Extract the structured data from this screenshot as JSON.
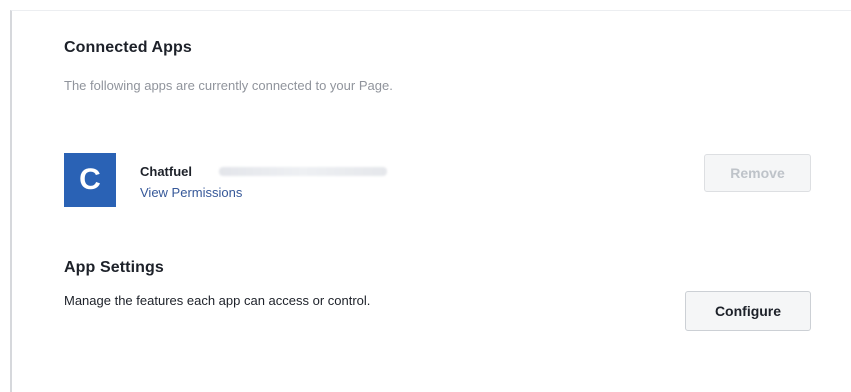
{
  "connected_apps": {
    "title": "Connected Apps",
    "description": "The following apps are currently connected to your Page.",
    "apps": [
      {
        "icon_letter": "C",
        "icon_color": "#2a62b5",
        "name": "Chatfuel",
        "link_label": "View Permissions",
        "remove_label": "Remove"
      }
    ]
  },
  "app_settings": {
    "title": "App Settings",
    "description": "Manage the features each app can access or control.",
    "configure_label": "Configure"
  },
  "colors": {
    "link": "#365899",
    "muted_text": "#90949c",
    "disabled_button_text": "#bec3c9"
  }
}
